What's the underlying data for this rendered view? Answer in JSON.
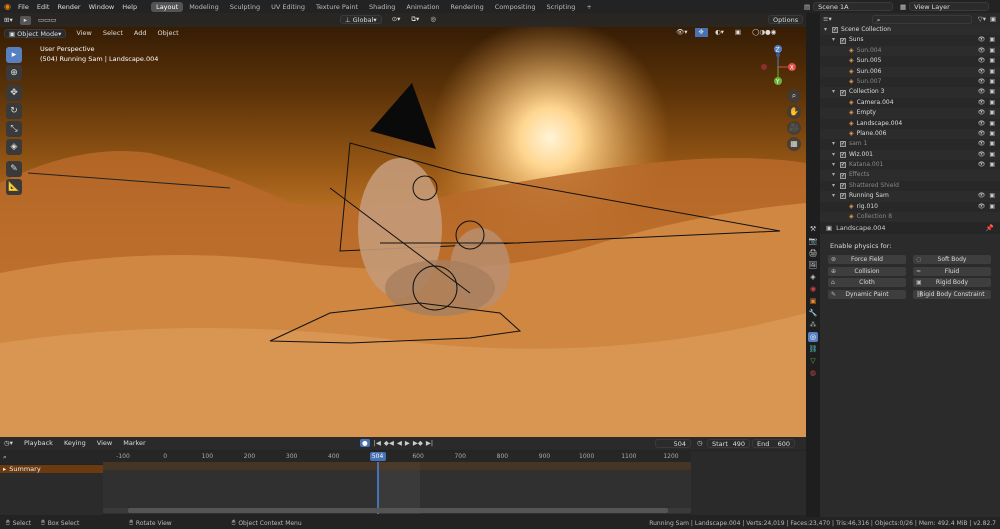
{
  "topbar": {
    "menus": [
      "File",
      "Edit",
      "Render",
      "Window",
      "Help"
    ],
    "workspaces": [
      "Layout",
      "Modeling",
      "Sculpting",
      "UV Editing",
      "Texture Paint",
      "Shading",
      "Animation",
      "Rendering",
      "Compositing",
      "Scripting"
    ],
    "active_workspace": "Layout",
    "add_tab": "+",
    "scene": "Scene 1A",
    "view_layer": "View Layer"
  },
  "viewport": {
    "mode": "Object Mode",
    "menus": [
      "View",
      "Select",
      "Add",
      "Object"
    ],
    "orientation": "Global",
    "options": "Options",
    "overlay_line1": "User Perspective",
    "overlay_line2": "(504) Running Sam | Landscape.004",
    "gizmo_labels": {
      "z": "Z",
      "x": "X",
      "y": "Y"
    }
  },
  "outliner": {
    "search_placeholder": "",
    "items": [
      {
        "label": "Scene Collection",
        "indent": 0,
        "dim": false,
        "icons": ""
      },
      {
        "label": "Suns",
        "indent": 1,
        "dim": false,
        "icons": "👁 ▣"
      },
      {
        "label": "Sun.004",
        "indent": 2,
        "dim": true,
        "icons": "👁 ▣"
      },
      {
        "label": "Sun.005",
        "indent": 2,
        "dim": false,
        "icons": "👁 ▣"
      },
      {
        "label": "Sun.006",
        "indent": 2,
        "dim": false,
        "icons": "👁 ▣"
      },
      {
        "label": "Sun.007",
        "indent": 2,
        "dim": true,
        "icons": "👁 ▣"
      },
      {
        "label": "Collection 3",
        "indent": 1,
        "dim": false,
        "icons": "👁 ▣"
      },
      {
        "label": "Camera.004",
        "indent": 2,
        "dim": false,
        "icons": "👁 ▣"
      },
      {
        "label": "Empty",
        "indent": 2,
        "dim": false,
        "icons": "👁 ▣"
      },
      {
        "label": "Landscape.004",
        "indent": 2,
        "dim": false,
        "icons": "👁 ▣"
      },
      {
        "label": "Plane.006",
        "indent": 2,
        "dim": false,
        "icons": "👁 ▣"
      },
      {
        "label": "sam 1",
        "indent": 1,
        "dim": true,
        "icons": "👁 ▣"
      },
      {
        "label": "Wiz.001",
        "indent": 1,
        "dim": false,
        "icons": "👁 ▣"
      },
      {
        "label": "Katana.001",
        "indent": 1,
        "dim": true,
        "icons": "👁 ▣"
      },
      {
        "label": "Effects",
        "indent": 1,
        "dim": true,
        "icons": ""
      },
      {
        "label": "Shattered Shield",
        "indent": 1,
        "dim": true,
        "icons": ""
      },
      {
        "label": "Running Sam",
        "indent": 1,
        "dim": false,
        "icons": "👁 ▣"
      },
      {
        "label": "rig.010",
        "indent": 2,
        "dim": false,
        "icons": "👁 ▣"
      },
      {
        "label": "Collection 8",
        "indent": 2,
        "dim": true,
        "icons": ""
      }
    ]
  },
  "properties": {
    "object_name": "Landscape.004",
    "section_label": "Enable physics for:",
    "buttons": [
      [
        "Force Field",
        "Soft Body"
      ],
      [
        "Collision",
        "Fluid"
      ],
      [
        "Cloth",
        "Rigid Body"
      ],
      [
        "Dynamic Paint",
        "Rigid Body Constraint"
      ]
    ]
  },
  "timeline": {
    "menus": [
      "Playback",
      "Keying",
      "View",
      "Marker"
    ],
    "current_frame": "504",
    "start_label": "Start",
    "start": "490",
    "end_label": "End",
    "end": "600",
    "summary": "Summary",
    "ruler_ticks": [
      "-100",
      "0",
      "100",
      "200",
      "300",
      "400",
      "504",
      "600",
      "700",
      "800",
      "900",
      "1000",
      "1100",
      "1200"
    ]
  },
  "status": {
    "select": "Select",
    "box_select": "Box Select",
    "rotate_view": "Rotate View",
    "context_menu": "Object Context Menu",
    "stats": "Running Sam | Landscape.004 | Verts:24,019 | Faces:23,470 | Tris:46,316 | Objects:0/26 | Mem: 492.4 MiB | v2.82.7"
  },
  "colors": {
    "accent": "#5680c2",
    "active_frame": "#4772b3",
    "header": "#232323"
  }
}
